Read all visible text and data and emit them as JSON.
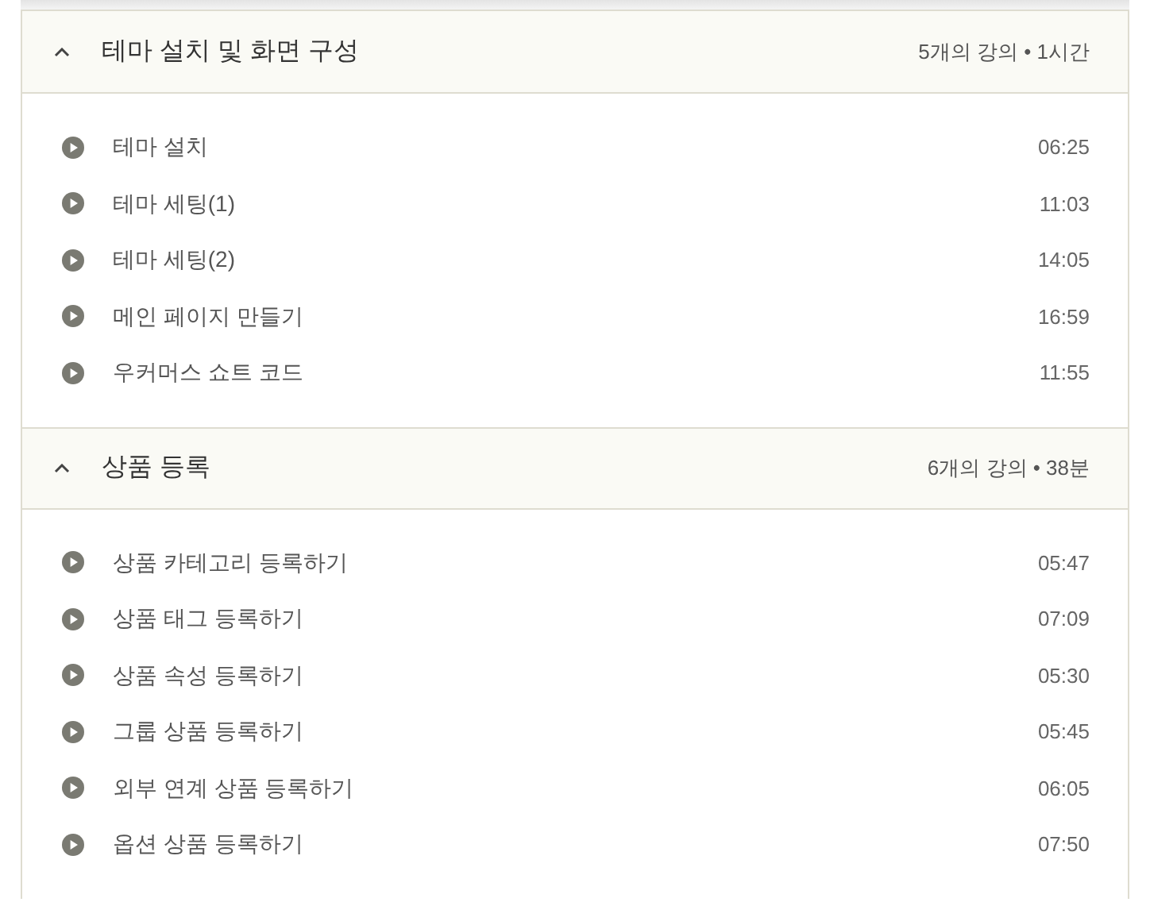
{
  "sections": [
    {
      "title": "테마 설치 및 화면 구성",
      "meta": "5개의 강의 • 1시간",
      "expanded": true,
      "lectures": [
        {
          "title": "테마 설치",
          "duration": "06:25"
        },
        {
          "title": "테마 세팅(1)",
          "duration": "11:03"
        },
        {
          "title": "테마 세팅(2)",
          "duration": "14:05"
        },
        {
          "title": "메인 페이지 만들기",
          "duration": "16:59"
        },
        {
          "title": "우커머스 쇼트 코드",
          "duration": "11:55"
        }
      ]
    },
    {
      "title": "상품 등록",
      "meta": "6개의 강의 • 38분",
      "expanded": true,
      "lectures": [
        {
          "title": "상품 카테고리 등록하기",
          "duration": "05:47"
        },
        {
          "title": "상품 태그 등록하기",
          "duration": "07:09"
        },
        {
          "title": "상품 속성 등록하기",
          "duration": "05:30"
        },
        {
          "title": "그룹 상품 등록하기",
          "duration": "05:45"
        },
        {
          "title": "외부 연계 상품 등록하기",
          "duration": "06:05"
        },
        {
          "title": "옵션 상품 등록하기",
          "duration": "07:50"
        }
      ]
    }
  ]
}
